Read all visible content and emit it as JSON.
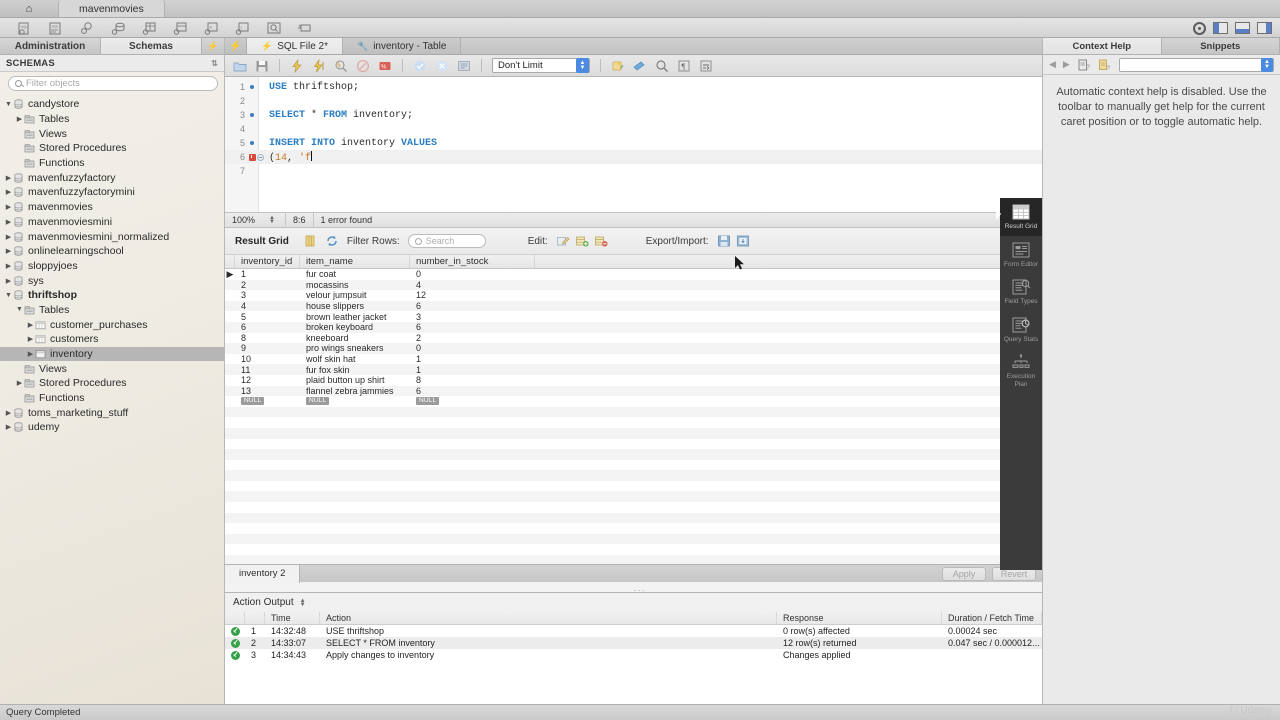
{
  "window": {
    "home_tab": "home-icon",
    "connection_tab": "mavenmovies"
  },
  "main_toolbar": {
    "icons": [
      "new-sql-tab-icon",
      "open-sql-script-icon",
      "new-connection-icon",
      "new-schema-icon",
      "new-table-icon",
      "new-view-icon",
      "new-procedure-icon",
      "new-function-icon",
      "search-icon",
      "reconnect-icon"
    ],
    "right_icons": [
      "gear-icon",
      "toggle-left-panel-icon",
      "toggle-bottom-panel-icon",
      "toggle-right-panel-icon"
    ]
  },
  "sidebar": {
    "tabs": [
      {
        "label": "Administration",
        "active": false
      },
      {
        "label": "Schemas",
        "active": true
      }
    ],
    "header": "SCHEMAS",
    "filter_placeholder": "Filter objects",
    "tree": [
      {
        "label": "candystore",
        "depth": 0,
        "arrow": "down",
        "icon": "database-icon",
        "selected": false,
        "bold": false
      },
      {
        "label": "Tables",
        "depth": 1,
        "arrow": "right",
        "icon": "folder-icon",
        "selected": false,
        "bold": false
      },
      {
        "label": "Views",
        "depth": 1,
        "arrow": "none",
        "icon": "folder-icon",
        "selected": false,
        "bold": false
      },
      {
        "label": "Stored Procedures",
        "depth": 1,
        "arrow": "none",
        "icon": "folder-icon",
        "selected": false,
        "bold": false
      },
      {
        "label": "Functions",
        "depth": 1,
        "arrow": "none",
        "icon": "folder-icon",
        "selected": false,
        "bold": false
      },
      {
        "label": "mavenfuzzyfactory",
        "depth": 0,
        "arrow": "right",
        "icon": "database-icon",
        "selected": false,
        "bold": false
      },
      {
        "label": "mavenfuzzyfactorymini",
        "depth": 0,
        "arrow": "right",
        "icon": "database-icon",
        "selected": false,
        "bold": false
      },
      {
        "label": "mavenmovies",
        "depth": 0,
        "arrow": "right",
        "icon": "database-icon",
        "selected": false,
        "bold": false
      },
      {
        "label": "mavenmoviesmini",
        "depth": 0,
        "arrow": "right",
        "icon": "database-icon",
        "selected": false,
        "bold": false
      },
      {
        "label": "mavenmoviesmini_normalized",
        "depth": 0,
        "arrow": "right",
        "icon": "database-icon",
        "selected": false,
        "bold": false
      },
      {
        "label": "onlinelearningschool",
        "depth": 0,
        "arrow": "right",
        "icon": "database-icon",
        "selected": false,
        "bold": false
      },
      {
        "label": "sloppyjoes",
        "depth": 0,
        "arrow": "right",
        "icon": "database-icon",
        "selected": false,
        "bold": false
      },
      {
        "label": "sys",
        "depth": 0,
        "arrow": "right",
        "icon": "database-icon",
        "selected": false,
        "bold": false
      },
      {
        "label": "thriftshop",
        "depth": 0,
        "arrow": "down",
        "icon": "database-icon",
        "selected": false,
        "bold": true
      },
      {
        "label": "Tables",
        "depth": 1,
        "arrow": "down",
        "icon": "folder-icon",
        "selected": false,
        "bold": false
      },
      {
        "label": "customer_purchases",
        "depth": 2,
        "arrow": "right",
        "icon": "table-icon",
        "selected": false,
        "bold": false
      },
      {
        "label": "customers",
        "depth": 2,
        "arrow": "right",
        "icon": "table-icon",
        "selected": false,
        "bold": false
      },
      {
        "label": "inventory",
        "depth": 2,
        "arrow": "right",
        "icon": "table-icon",
        "selected": true,
        "bold": false
      },
      {
        "label": "Views",
        "depth": 1,
        "arrow": "none",
        "icon": "folder-icon",
        "selected": false,
        "bold": false
      },
      {
        "label": "Stored Procedures",
        "depth": 1,
        "arrow": "right",
        "icon": "folder-icon",
        "selected": false,
        "bold": false
      },
      {
        "label": "Functions",
        "depth": 1,
        "arrow": "none",
        "icon": "folder-icon",
        "selected": false,
        "bold": false
      },
      {
        "label": "toms_marketing_stuff",
        "depth": 0,
        "arrow": "right",
        "icon": "database-icon",
        "selected": false,
        "bold": false
      },
      {
        "label": "udemy",
        "depth": 0,
        "arrow": "right",
        "icon": "database-icon",
        "selected": false,
        "bold": false
      }
    ]
  },
  "editor": {
    "tabs": [
      {
        "label": "SQL File 2*",
        "active": true,
        "icon": "lightning-icon"
      },
      {
        "label": "inventory - Table",
        "active": false,
        "icon": "wrench-icon"
      }
    ],
    "toolbar": {
      "icons": [
        "open-file-icon",
        "save-file-icon",
        "execute-icon",
        "execute-statement-icon",
        "explain-icon",
        "stop-icon",
        "stop-on-error-icon",
        "commit-icon",
        "rollback-icon",
        "autocommit-icon"
      ],
      "limit_value": "Don't Limit",
      "right_icons": [
        "snippet-icon",
        "beautify-icon",
        "find-icon",
        "invisible-chars-icon",
        "wrap-lines-icon"
      ]
    },
    "lines": [
      {
        "n": "1",
        "marker": "dot",
        "tokens": [
          {
            "t": "USE",
            "c": "kw"
          },
          {
            "t": " thriftshop;",
            "c": "plain"
          }
        ]
      },
      {
        "n": "2",
        "marker": "",
        "tokens": []
      },
      {
        "n": "3",
        "marker": "dot",
        "tokens": [
          {
            "t": "SELECT",
            "c": "kw"
          },
          {
            "t": " * ",
            "c": "plain"
          },
          {
            "t": "FROM",
            "c": "kw"
          },
          {
            "t": " inventory;",
            "c": "plain"
          }
        ]
      },
      {
        "n": "4",
        "marker": "",
        "tokens": []
      },
      {
        "n": "5",
        "marker": "dot",
        "tokens": [
          {
            "t": "INSERT INTO",
            "c": "kw"
          },
          {
            "t": " inventory ",
            "c": "plain"
          },
          {
            "t": "VALUES",
            "c": "kw"
          }
        ]
      },
      {
        "n": "6",
        "marker": "error",
        "tokens": [
          {
            "t": "(",
            "c": "plain"
          },
          {
            "t": "14",
            "c": "num"
          },
          {
            "t": ", ",
            "c": "plain"
          },
          {
            "t": "'f",
            "c": "str"
          }
        ]
      },
      {
        "n": "7",
        "marker": "",
        "tokens": []
      }
    ],
    "statusline": {
      "zoom": "100%",
      "caret": "8:6",
      "message": "1 error found"
    }
  },
  "result_toolbar": {
    "title": "Result Grid",
    "filter_label": "Filter Rows:",
    "search_placeholder": "Search",
    "edit_label": "Edit:",
    "export_label": "Export/Import:",
    "icons": [
      "grid-view-icon",
      "refresh-icon",
      "edit-row-icon",
      "insert-row-icon",
      "delete-row-icon",
      "export-recordset-icon",
      "import-recordset-icon",
      "wrap-cell-content-icon"
    ]
  },
  "grid": {
    "columns": [
      "inventory_id",
      "item_name",
      "number_in_stock"
    ],
    "rows": [
      {
        "inventory_id": "1",
        "item_name": "fur coat",
        "number_in_stock": "0",
        "marker": true
      },
      {
        "inventory_id": "2",
        "item_name": "mocassins",
        "number_in_stock": "4",
        "marker": false
      },
      {
        "inventory_id": "3",
        "item_name": "velour jumpsuit",
        "number_in_stock": "12",
        "marker": false
      },
      {
        "inventory_id": "4",
        "item_name": "house slippers",
        "number_in_stock": "6",
        "marker": false
      },
      {
        "inventory_id": "5",
        "item_name": "brown leather jacket",
        "number_in_stock": "3",
        "marker": false
      },
      {
        "inventory_id": "6",
        "item_name": "broken keyboard",
        "number_in_stock": "6",
        "marker": false
      },
      {
        "inventory_id": "8",
        "item_name": "kneeboard",
        "number_in_stock": "2",
        "marker": false
      },
      {
        "inventory_id": "9",
        "item_name": "pro wings sneakers",
        "number_in_stock": "0",
        "marker": false
      },
      {
        "inventory_id": "10",
        "item_name": "wolf skin hat",
        "number_in_stock": "1",
        "marker": false
      },
      {
        "inventory_id": "11",
        "item_name": "fur fox skin",
        "number_in_stock": "1",
        "marker": false
      },
      {
        "inventory_id": "12",
        "item_name": "plaid button up shirt",
        "number_in_stock": "8",
        "marker": false
      },
      {
        "inventory_id": "13",
        "item_name": "flannel zebra jammies",
        "number_in_stock": "6",
        "marker": false
      }
    ],
    "null_label": "NULL"
  },
  "result_footer": {
    "tab_label": "inventory 2",
    "apply_label": "Apply",
    "revert_label": "Revert"
  },
  "tool_strip": {
    "items": [
      {
        "label": "Result\nGrid",
        "icon": "result-grid-icon",
        "active": true
      },
      {
        "label": "Form\nEditor",
        "icon": "form-editor-icon",
        "active": false
      },
      {
        "label": "Field\nTypes",
        "icon": "field-types-icon",
        "active": false
      },
      {
        "label": "Query\nStats",
        "icon": "query-stats-icon",
        "active": false
      },
      {
        "label": "Execution\nPlan",
        "icon": "execution-plan-icon",
        "active": false
      }
    ]
  },
  "action_output": {
    "title": "Action Output",
    "columns": [
      "",
      "",
      "Time",
      "Action",
      "Response",
      "Duration / Fetch Time"
    ],
    "rows": [
      {
        "status": "success",
        "n": "1",
        "time": "14:32:48",
        "action": "USE thriftshop",
        "response": "0 row(s) affected",
        "duration": "0.00024 sec"
      },
      {
        "status": "success",
        "n": "2",
        "time": "14:33:07",
        "action": "SELECT * FROM inventory",
        "response": "12 row(s) returned",
        "duration": "0.047 sec / 0.000012..."
      },
      {
        "status": "success",
        "n": "3",
        "time": "14:34:43",
        "action": "Apply changes to inventory",
        "response": "Changes applied",
        "duration": ""
      }
    ]
  },
  "right_panel": {
    "tabs": [
      {
        "label": "Context Help",
        "active": true
      },
      {
        "label": "Snippets",
        "active": false
      }
    ],
    "toolbar_icons": [
      "back-arrow-icon",
      "forward-arrow-icon",
      "manual-help-icon",
      "toggle-automatic-help-icon"
    ],
    "body_text": "Automatic context help is disabled. Use the toolbar to manually get help for the current caret position or to toggle automatic help."
  },
  "statusbar": {
    "message": "Query Completed",
    "watermark": "Udemy"
  },
  "colors": {
    "accent_blue": "#4a8ae0",
    "keyword_blue": "#2b7ec4",
    "literal_orange": "#c07a28",
    "error_red": "#d94a3d",
    "success_green": "#35a24a",
    "toolstrip_dark": "#3b3b3b",
    "selection_gray": "#b6b6b6"
  }
}
